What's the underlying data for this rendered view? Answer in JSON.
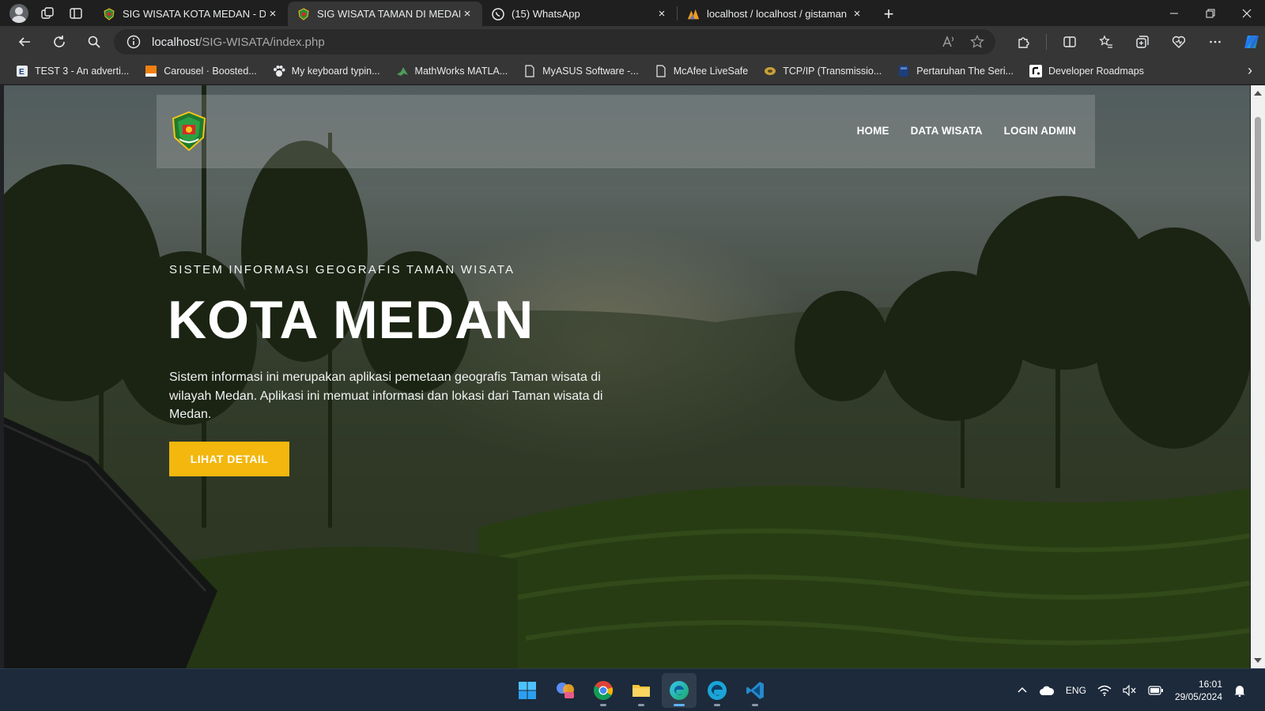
{
  "browser": {
    "tabs": [
      {
        "title": "SIG WISATA KOTA MEDAN - Dasl",
        "favicon": "medan-emblem-icon",
        "active": false
      },
      {
        "title": "SIG WISATA TAMAN DI MEDAN",
        "favicon": "medan-emblem-icon",
        "active": true
      },
      {
        "title": "(15) WhatsApp",
        "favicon": "whatsapp-icon",
        "active": false
      },
      {
        "title": "localhost / localhost / gistaman |",
        "favicon": "phpmyadmin-icon",
        "active": false
      }
    ],
    "close_glyph": "×",
    "new_tab_glyph": "+",
    "url_host": "localhost",
    "url_path": "/SIG-WISATA/index.php"
  },
  "bookmarks": [
    {
      "label": "TEST 3 - An adverti...",
      "icon": "test-icon"
    },
    {
      "label": "Carousel · Boosted...",
      "icon": "carousel-icon"
    },
    {
      "label": "My keyboard typin...",
      "icon": "paw-icon"
    },
    {
      "label": "MathWorks MATLA...",
      "icon": "matlab-icon"
    },
    {
      "label": "MyASUS Software -...",
      "icon": "page-icon"
    },
    {
      "label": "McAfee LiveSafe",
      "icon": "page-icon"
    },
    {
      "label": "TCP/IP (Transmissio...",
      "icon": "network-icon"
    },
    {
      "label": "Pertaruhan The Seri...",
      "icon": "book-icon"
    },
    {
      "label": "Developer Roadmaps",
      "icon": "roadmap-icon"
    }
  ],
  "site": {
    "nav": [
      "HOME",
      "DATA WISATA",
      "LOGIN ADMIN"
    ],
    "hero_subtitle": "SISTEM INFORMASI GEOGRAFIS TAMAN WISATA",
    "hero_title": "KOTA MEDAN",
    "hero_description": "Sistem informasi ini merupakan aplikasi pemetaan geografis Taman wisata di wilayah Medan. Aplikasi ini memuat informasi dan lokasi dari Taman wisata di Medan.",
    "hero_button": "LIHAT DETAIL",
    "accent_color": "#f3b70d"
  },
  "taskbar": {
    "apps": [
      "start-icon",
      "widgets-icon",
      "chrome-icon",
      "file-explorer-icon",
      "edge-icon",
      "edge-dev-icon",
      "vscode-icon"
    ],
    "language": "ENG",
    "time": "16:01",
    "date": "29/05/2024"
  }
}
